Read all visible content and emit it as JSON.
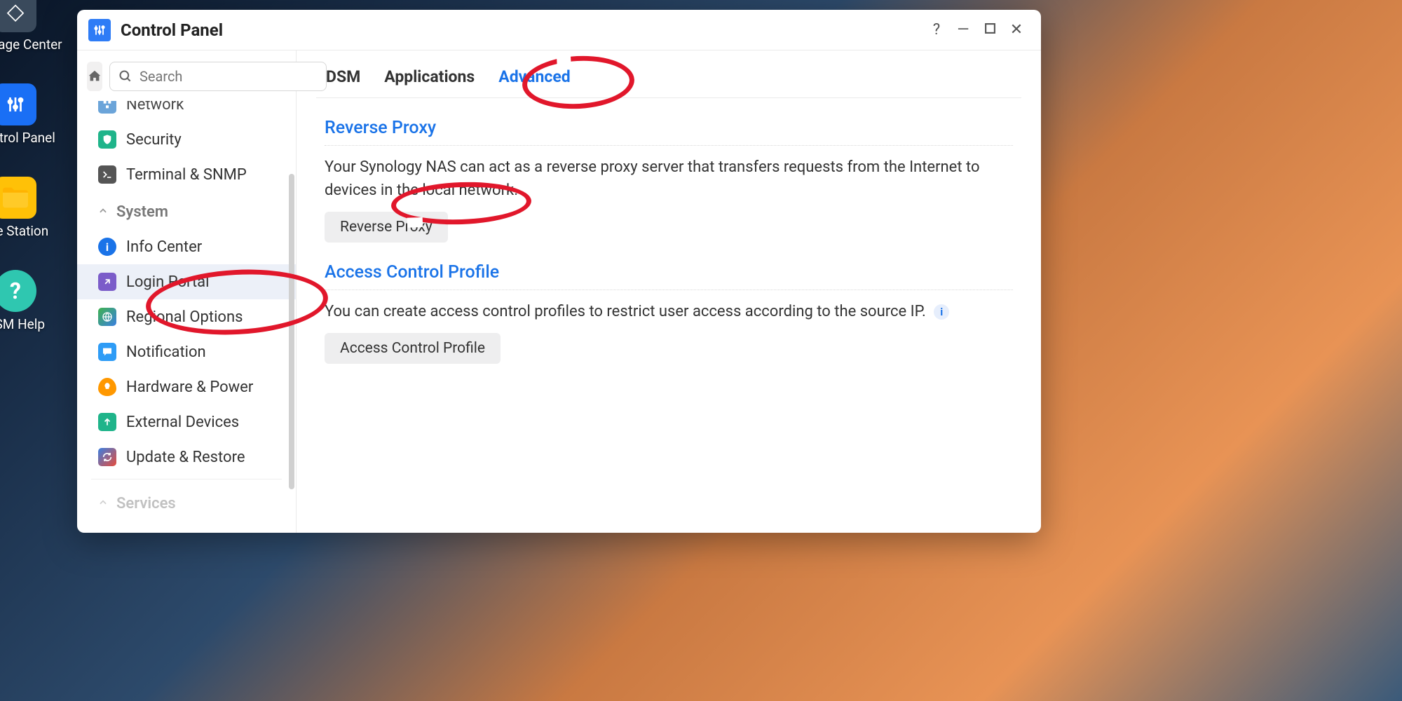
{
  "desktop": {
    "icons": [
      {
        "label": "Package Center"
      },
      {
        "label": "Control Panel"
      },
      {
        "label": "File Station"
      },
      {
        "label": "DSM Help"
      }
    ]
  },
  "window": {
    "title": "Control Panel"
  },
  "search": {
    "placeholder": "Search"
  },
  "sidebar": {
    "items_top": [
      {
        "label": "Network"
      },
      {
        "label": "Security"
      },
      {
        "label": "Terminal & SNMP"
      }
    ],
    "section_system": "System",
    "items_system": [
      {
        "label": "Info Center"
      },
      {
        "label": "Login Portal"
      },
      {
        "label": "Regional Options"
      },
      {
        "label": "Notification"
      },
      {
        "label": "Hardware & Power"
      },
      {
        "label": "External Devices"
      },
      {
        "label": "Update & Restore"
      }
    ],
    "section_services": "Services"
  },
  "tabs": {
    "dsm": "DSM",
    "applications": "Applications",
    "advanced": "Advanced"
  },
  "sections": {
    "reverse_proxy": {
      "title": "Reverse Proxy",
      "text": "Your Synology NAS can act as a reverse proxy server that transfers requests from the Internet to devices in the local network.",
      "button": "Reverse Proxy"
    },
    "access_control": {
      "title": "Access Control Profile",
      "text": "You can create access control profiles to restrict user access according to the source IP.",
      "button": "Access Control Profile"
    }
  }
}
